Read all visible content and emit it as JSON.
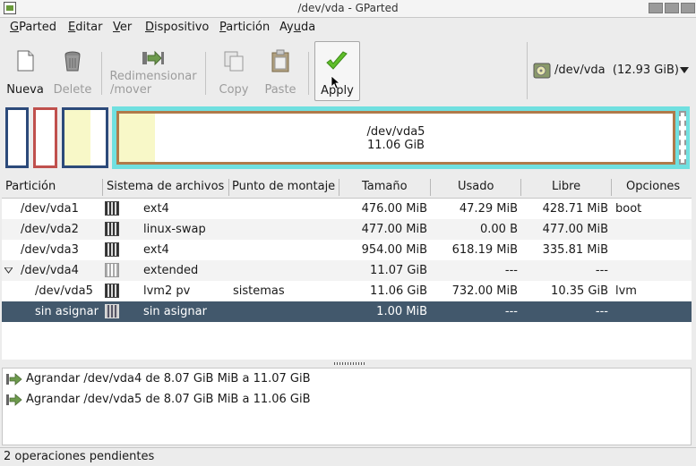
{
  "window": {
    "title": "/dev/vda - GParted"
  },
  "menu": [
    {
      "pre": "",
      "u": "G",
      "post": "Parted"
    },
    {
      "pre": "",
      "u": "E",
      "post": "ditar"
    },
    {
      "pre": "",
      "u": "V",
      "post": "er"
    },
    {
      "pre": "",
      "u": "D",
      "post": "ispositivo"
    },
    {
      "pre": "",
      "u": "P",
      "post": "artición"
    },
    {
      "pre": "Ay",
      "u": "u",
      "post": "da"
    }
  ],
  "toolbar": {
    "new_label": "Nueva",
    "delete_label": "Delete",
    "resize_label_1": "Redimensionar",
    "resize_label_2": "/mover",
    "copy_label": "Copy",
    "paste_label": "Paste",
    "apply_label": "Apply"
  },
  "device": {
    "name": "/dev/vda",
    "size": "(12.93 GiB)"
  },
  "graph": {
    "main_name": "/dev/vda5",
    "main_size": "11.06 GiB"
  },
  "table": {
    "headers": [
      "Partición",
      "Sistema de archivos",
      "Punto de montaje",
      "Tamaño",
      "Usado",
      "Libre",
      "Opciones"
    ],
    "rows": [
      {
        "partition": "/dev/vda1",
        "fs": "ext4",
        "mount": "",
        "size": "476.00 MiB",
        "used": "47.29 MiB",
        "free": "428.71 MiB",
        "opts": "boot"
      },
      {
        "partition": "/dev/vda2",
        "fs": "linux-swap",
        "mount": "",
        "size": "477.00 MiB",
        "used": "0.00 B",
        "free": "477.00 MiB",
        "opts": ""
      },
      {
        "partition": "/dev/vda3",
        "fs": "ext4",
        "mount": "",
        "size": "954.00 MiB",
        "used": "618.19 MiB",
        "free": "335.81 MiB",
        "opts": ""
      },
      {
        "partition": "/dev/vda4",
        "fs": "extended",
        "mount": "",
        "size": "11.07 GiB",
        "used": "---",
        "free": "---",
        "opts": ""
      },
      {
        "partition": "/dev/vda5",
        "fs": "lvm2 pv",
        "mount": "sistemas",
        "size": "11.06 GiB",
        "used": "732.00 MiB",
        "free": "10.35 GiB",
        "opts": "lvm"
      },
      {
        "partition": "sin asignar",
        "fs": "sin asignar",
        "mount": "",
        "size": "1.00 MiB",
        "used": "---",
        "free": "---",
        "opts": ""
      }
    ]
  },
  "operations": [
    "Agrandar /dev/vda4 de 8.07 GiB MiB a 11.07 GiB",
    "Agrandar /dev/vda5 de 8.07 GiB MiB a 11.06 GiB"
  ],
  "status": {
    "text": "2 operaciones pendientes"
  },
  "colors": {
    "selection": "#42586c",
    "ext4": "#2c4a7a",
    "swap": "#c0504d",
    "extended": "#70e0e0",
    "lvm": "#b07a4a",
    "used": "#f8f8c8"
  }
}
